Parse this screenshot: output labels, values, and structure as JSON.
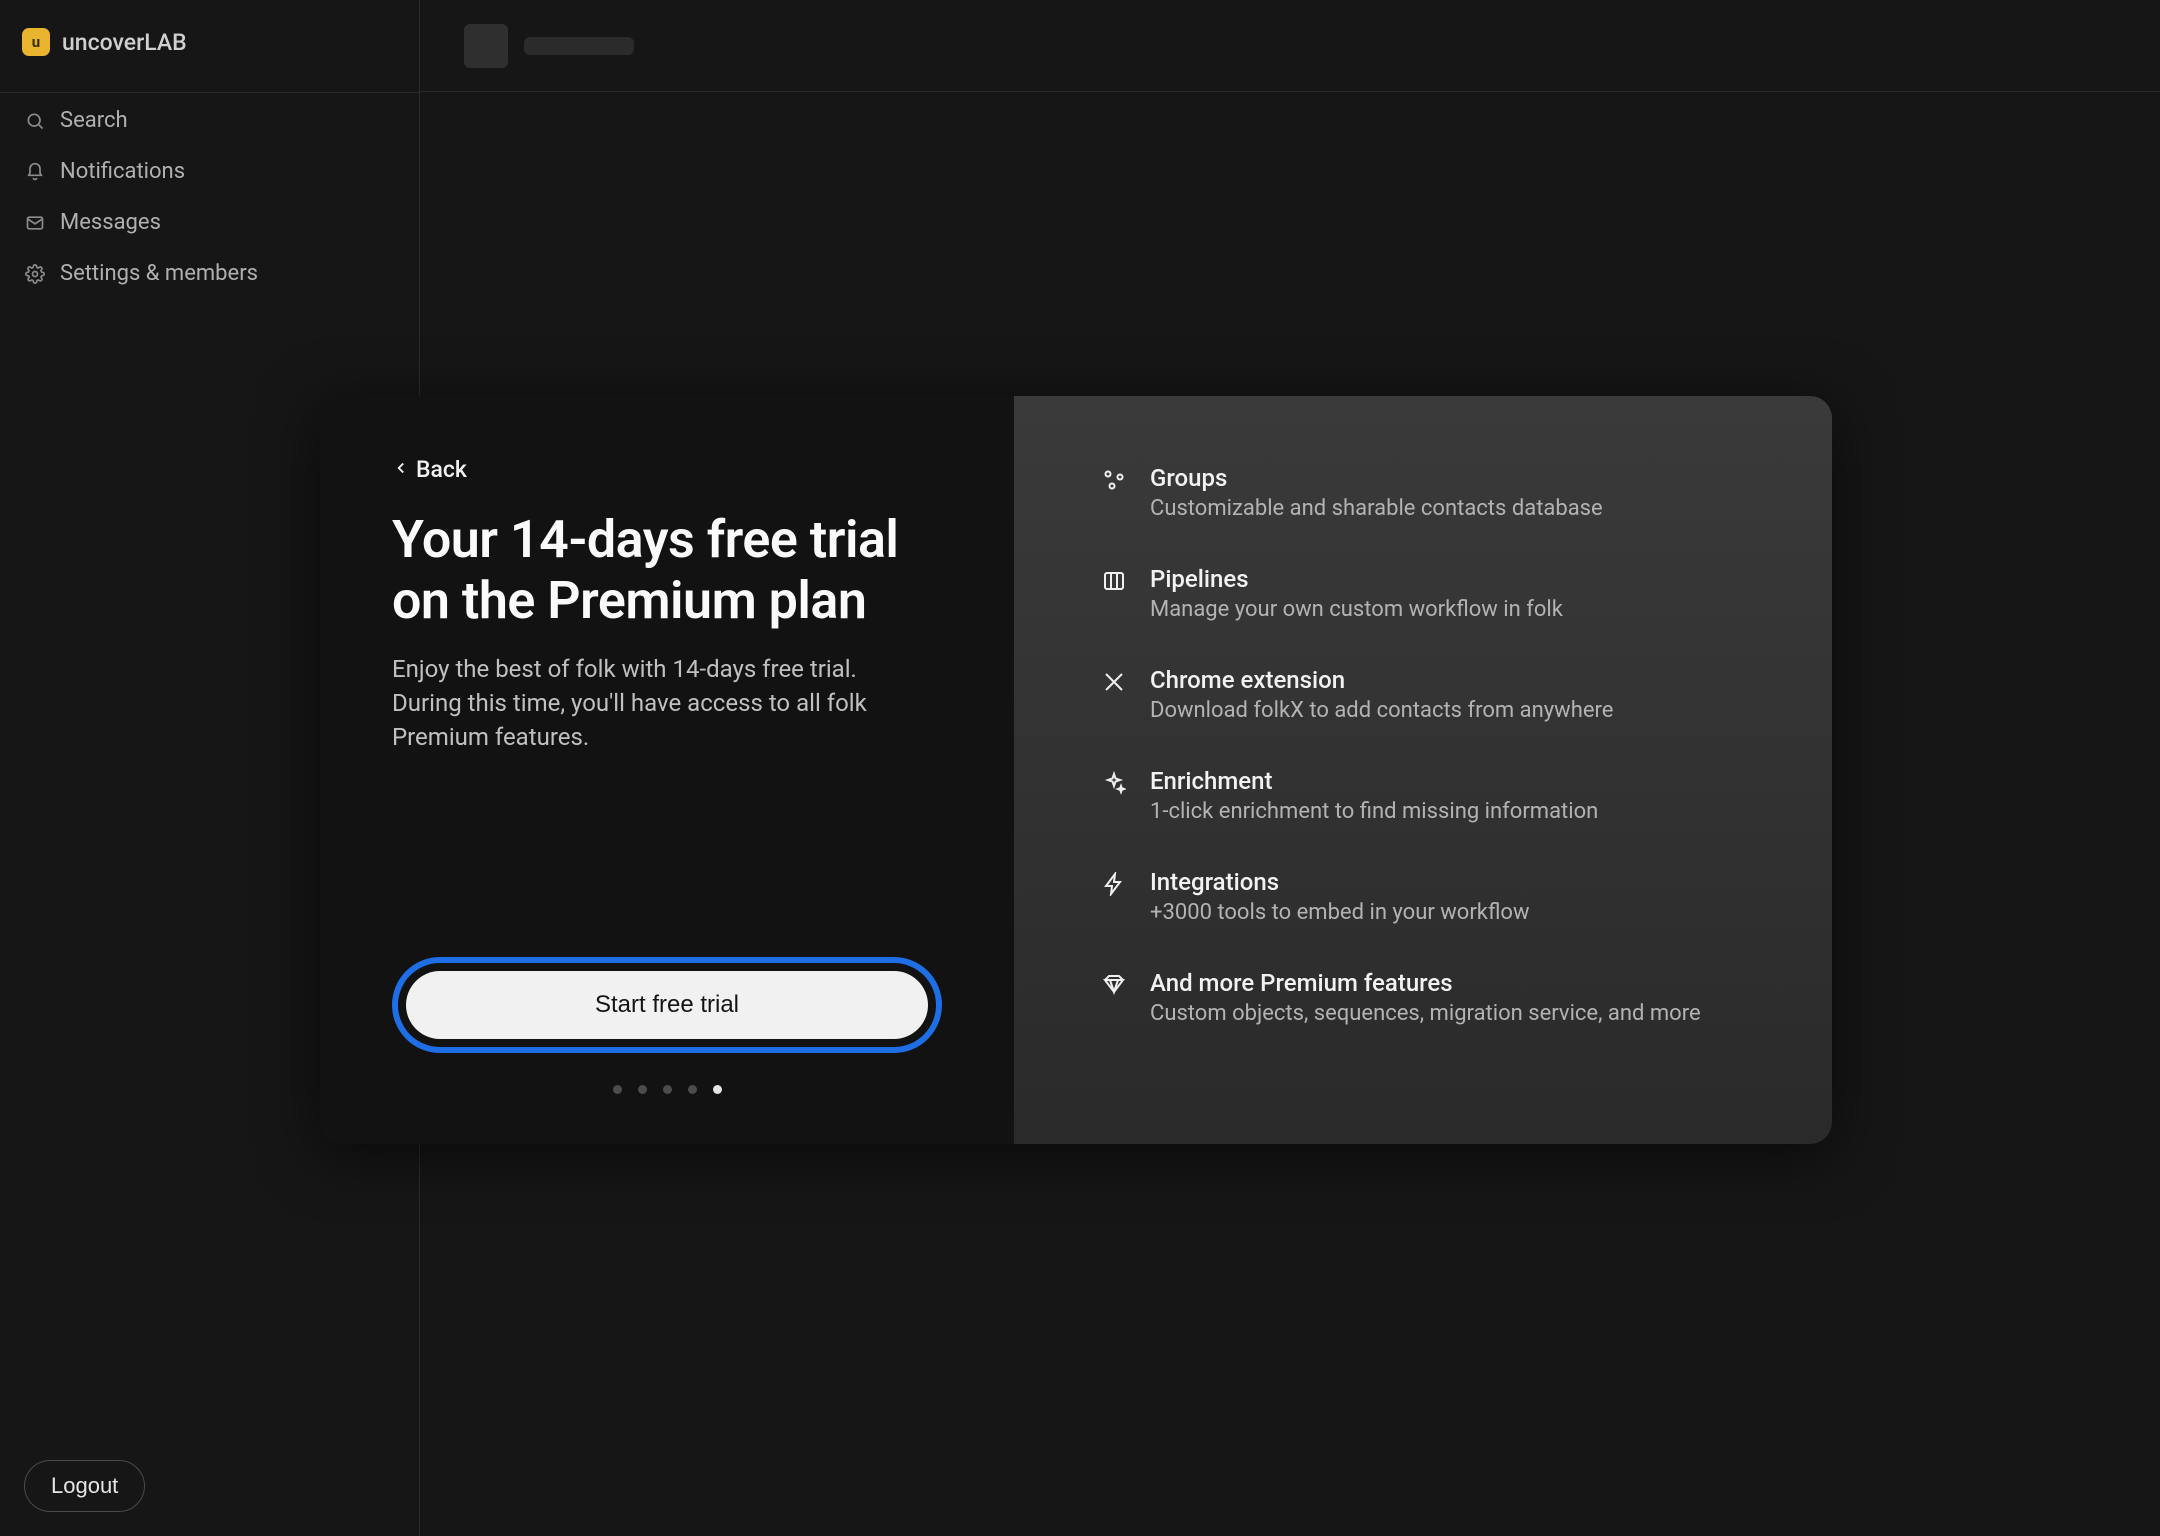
{
  "workspace": {
    "badge_letter": "u",
    "name": "uncoverLAB"
  },
  "sidebar": {
    "items": [
      {
        "label": "Search"
      },
      {
        "label": "Notifications"
      },
      {
        "label": "Messages"
      },
      {
        "label": "Settings & members"
      }
    ],
    "logout_label": "Logout"
  },
  "modal": {
    "back_label": "Back",
    "title": "Your 14-days free trial on the Premium plan",
    "subtitle": "Enjoy the best of folk with 14-days free trial. During this time, you'll have access to all folk Premium features.",
    "cta_label": "Start free trial",
    "step_count": 5,
    "active_step_index": 4
  },
  "features": [
    {
      "title": "Groups",
      "desc": "Customizable and sharable contacts database"
    },
    {
      "title": "Pipelines",
      "desc": "Manage your own custom workflow in folk"
    },
    {
      "title": "Chrome extension",
      "desc": "Download folkX to add contacts from anywhere"
    },
    {
      "title": "Enrichment",
      "desc": "1-click enrichment to find missing information"
    },
    {
      "title": "Integrations",
      "desc": "+3000 tools to embed in your workflow"
    },
    {
      "title": "And more Premium features",
      "desc": "Custom objects, sequences, migration service, and more"
    }
  ]
}
